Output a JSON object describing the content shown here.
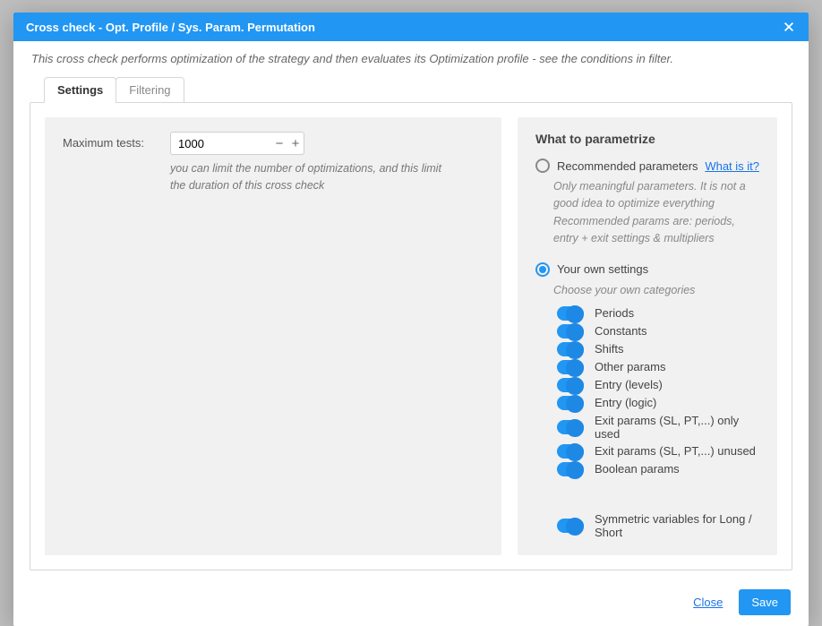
{
  "modal": {
    "title": "Cross check - Opt. Profile / Sys. Param. Permutation",
    "description": "This cross check performs optimization of the strategy and then evaluates its Optimization profile - see the conditions in filter."
  },
  "tabs": {
    "settings": "Settings",
    "filtering": "Filtering",
    "active": "settings"
  },
  "left": {
    "max_tests_label": "Maximum tests:",
    "max_tests_value": "1000",
    "max_tests_hint": "you can limit the number of optimizations, and this limit the duration of this cross check"
  },
  "right": {
    "title": "What to parametrize",
    "what_is_it": "What is it?",
    "options": {
      "recommended": {
        "label": "Recommended parameters",
        "desc": "Only meaningful parameters. It is not a good idea to optimize everything\nRecommended params are: periods, entry + exit settings & multipliers",
        "selected": false
      },
      "own": {
        "label": "Your own settings",
        "desc": "Choose your own categories",
        "selected": true
      }
    },
    "toggles": [
      {
        "label": "Periods",
        "on": true
      },
      {
        "label": "Constants",
        "on": true
      },
      {
        "label": "Shifts",
        "on": true
      },
      {
        "label": "Other params",
        "on": true
      },
      {
        "label": "Entry (levels)",
        "on": true
      },
      {
        "label": "Entry (logic)",
        "on": true
      },
      {
        "label": "Exit params (SL, PT,...) only used",
        "on": true
      },
      {
        "label": "Exit params (SL, PT,...) unused",
        "on": true
      },
      {
        "label": "Boolean params",
        "on": true
      }
    ],
    "symmetric": {
      "label": "Symmetric variables for Long / Short",
      "on": true
    }
  },
  "footer": {
    "close": "Close",
    "save": "Save"
  }
}
